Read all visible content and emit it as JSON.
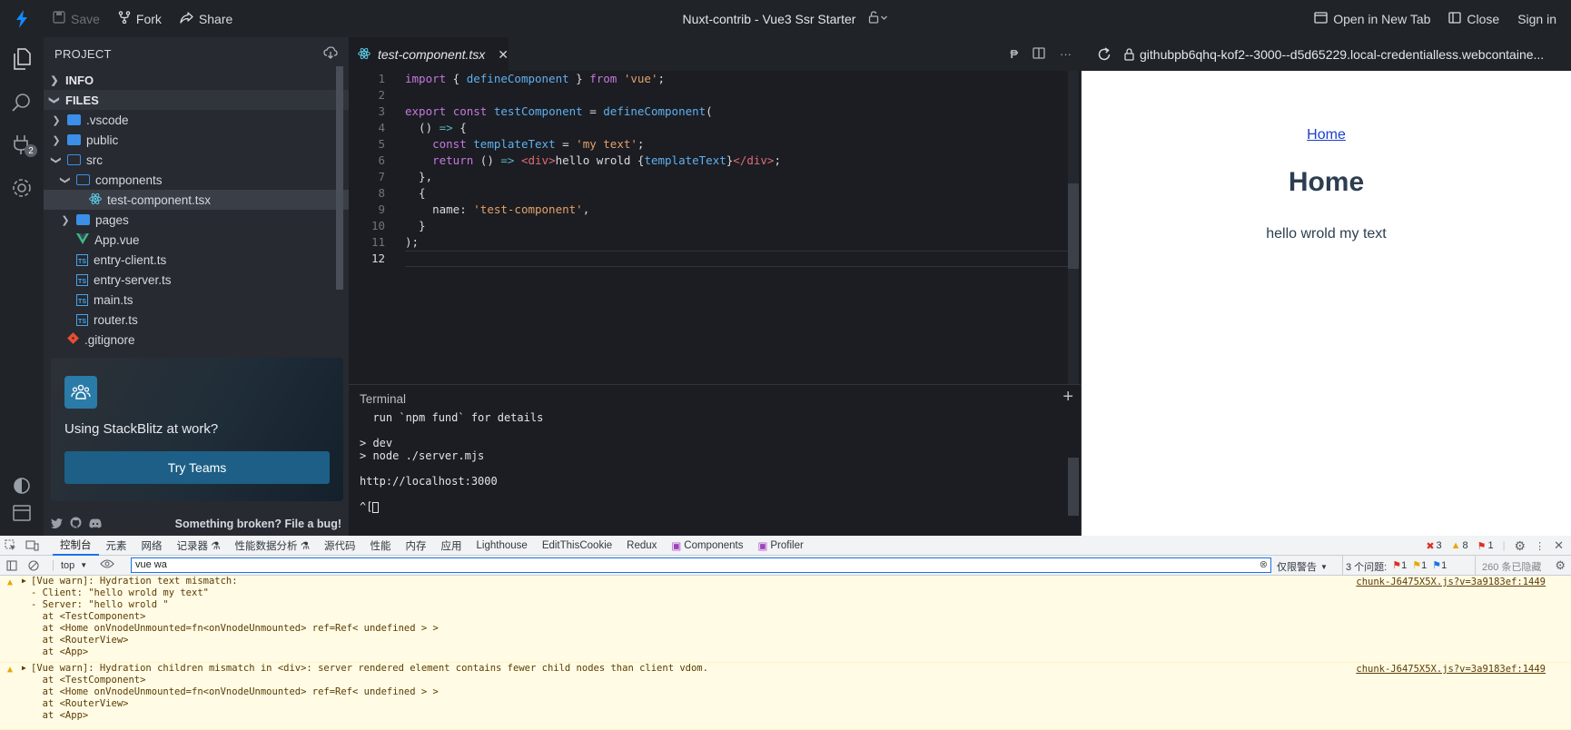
{
  "topbar": {
    "save": "Save",
    "fork": "Fork",
    "share": "Share",
    "title": "Nuxt-contrib - Vue3 Ssr Starter",
    "open_new_tab": "Open in New Tab",
    "close": "Close",
    "sign_in": "Sign in"
  },
  "activity": {
    "badge": "2"
  },
  "sidebar": {
    "header": "PROJECT",
    "info": "INFO",
    "files": "FILES",
    "tree": [
      {
        "label": ".vscode"
      },
      {
        "label": "public"
      },
      {
        "label": "src"
      },
      {
        "label": "components"
      },
      {
        "label": "test-component.tsx"
      },
      {
        "label": "pages"
      },
      {
        "label": "App.vue"
      },
      {
        "label": "entry-client.ts"
      },
      {
        "label": "entry-server.ts"
      },
      {
        "label": "main.ts"
      },
      {
        "label": "router.ts"
      },
      {
        "label": ".gitignore"
      }
    ],
    "card_text": "Using StackBlitz at work?",
    "card_button": "Try Teams",
    "footer_bug": "Something broken? File a bug!"
  },
  "editor": {
    "tab": "test-component.tsx",
    "line_numbers": [
      "1",
      "2",
      "3",
      "4",
      "5",
      "6",
      "7",
      "8",
      "9",
      "10",
      "11",
      "12"
    ],
    "current_line": "12"
  },
  "terminal": {
    "title": "Terminal",
    "lines": [
      "  run `npm fund` for details",
      "",
      "> dev",
      "> node ./server.mjs",
      "",
      "http://localhost:3000",
      "",
      "^["
    ]
  },
  "preview": {
    "url": "githubpb6qhq-kof2--3000--d5d65229.local-credentialless.webcontaine...",
    "link": "Home",
    "heading": "Home",
    "text": "hello wrold my text"
  },
  "devtools": {
    "tabs": [
      "控制台",
      "元素",
      "网络",
      "记录器 ⚗",
      "性能数据分析 ⚗",
      "源代码",
      "性能",
      "内存",
      "应用",
      "Lighthouse",
      "EditThisCookie",
      "Redux",
      "Components",
      "Profiler"
    ],
    "errors": "3",
    "warnings": "8",
    "issues": "1",
    "context": "top",
    "filter_value": "vue wa",
    "levels": "仅限警告",
    "issues_label": "3 个问题:",
    "issue_counts": [
      "1",
      "1",
      "1"
    ],
    "hidden": "260 条已隐藏",
    "messages": [
      {
        "source": "chunk-J6475X5X.js?v=3a9183ef:1449",
        "lines": [
          "[Vue warn]: Hydration text mismatch:",
          "- Client: \"hello wrold my text\"",
          "- Server: \"hello wrold \"",
          "  at <TestComponent>",
          "  at <Home onVnodeUnmounted=fn<onVnodeUnmounted> ref=Ref< undefined > >",
          "  at <RouterView>",
          "  at <App>"
        ]
      },
      {
        "source": "chunk-J6475X5X.js?v=3a9183ef:1449",
        "lines": [
          "[Vue warn]: Hydration children mismatch in <div>: server rendered element contains fewer child nodes than client vdom.",
          "  at <TestComponent>",
          "  at <Home onVnodeUnmounted=fn<onVnodeUnmounted> ref=Ref< undefined > >",
          "  at <RouterView>",
          "  at <App>"
        ]
      }
    ]
  },
  "colors": {
    "accent": "#1389fd",
    "folder": "#3b8fe8",
    "teams_button": "#1d5f86",
    "warn_bg": "#fffbe5"
  },
  "icons": [
    "bolt-logo-icon",
    "save-icon",
    "fork-icon",
    "share-icon",
    "lock-icon",
    "files-icon",
    "search-icon",
    "extensions-icon",
    "settings-icon",
    "theme-icon",
    "layout-icon",
    "twitter-icon",
    "github-icon",
    "discord-icon",
    "react-icon",
    "refresh-icon",
    "warning-icon"
  ]
}
